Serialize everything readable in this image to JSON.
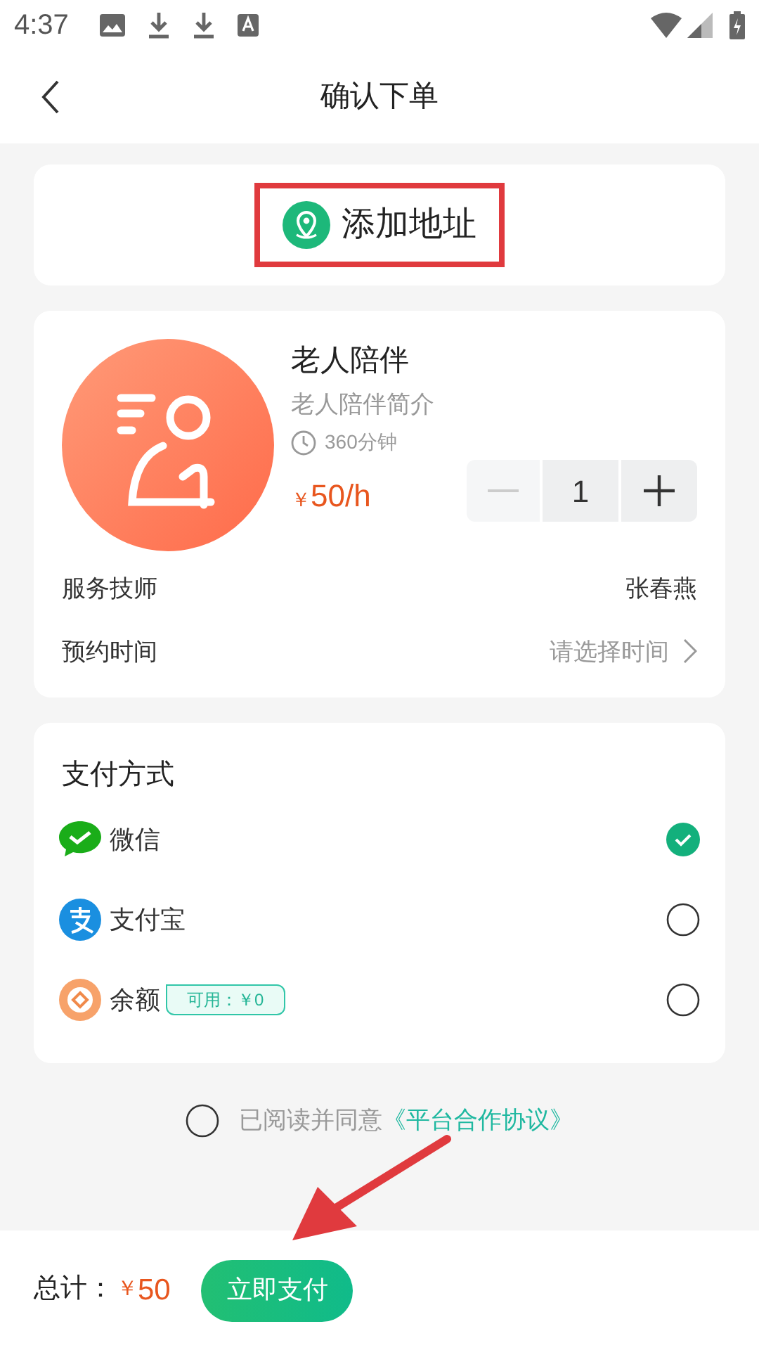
{
  "status_bar": {
    "time": "4:37"
  },
  "header": {
    "title": "确认下单"
  },
  "address": {
    "label": "添加地址",
    "highlighted": true
  },
  "service": {
    "name": "老人陪伴",
    "intro": "老人陪伴简介",
    "duration": "360分钟",
    "currency": "￥",
    "price": "50/h",
    "quantity": "1"
  },
  "details": [
    {
      "label": "服务技师",
      "value": "张春燕",
      "kind": "text"
    },
    {
      "label": "预约时间",
      "value": "请选择时间",
      "kind": "picker"
    }
  ],
  "payment": {
    "title": "支付方式",
    "methods": [
      {
        "name": "微信",
        "kind": "wechat",
        "selected": true
      },
      {
        "name": "支付宝",
        "kind": "alipay",
        "selected": false
      },
      {
        "name": "余额",
        "kind": "balance",
        "selected": false,
        "badge": "可用：￥0"
      }
    ]
  },
  "agreement": {
    "checked": false,
    "text": "已阅读并同意",
    "link": "《平台合作协议》"
  },
  "footer": {
    "total_label": "总计：",
    "currency": "￥",
    "total": "50",
    "pay_button": "立即支付"
  }
}
